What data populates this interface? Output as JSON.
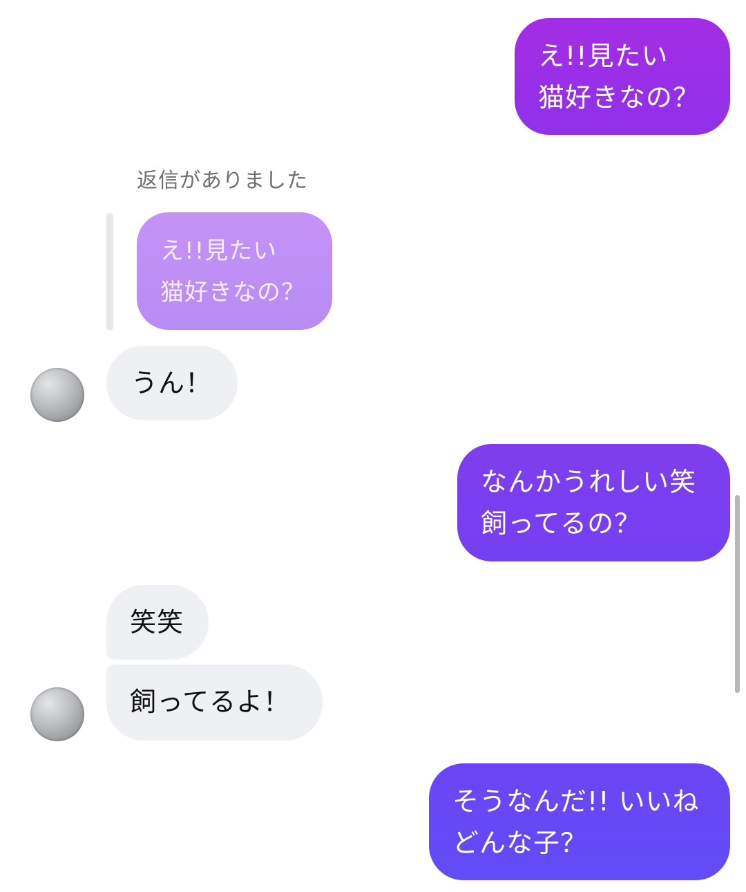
{
  "messages": {
    "sent_1": {
      "line1": "え!!見たい",
      "line2": "猫好きなの？"
    },
    "reply_caption": "返信がありました",
    "quoted": {
      "line1": "え!!見たい",
      "line2": "猫好きなの？"
    },
    "received_1": "うん！",
    "sent_2": {
      "line1": "なんかうれしい笑",
      "line2": "飼ってるの？"
    },
    "received_2": "笑笑",
    "received_3": "飼ってるよ！",
    "sent_3": {
      "line1": "そうなんだ!! いいね",
      "line2": "どんな子？"
    }
  },
  "colors": {
    "sent_gradient_top": "#a02fe6",
    "sent_gradient_bottom": "#5f4cf7",
    "received_bg": "#eff0f3",
    "quoted_bg": "#c39af7"
  }
}
